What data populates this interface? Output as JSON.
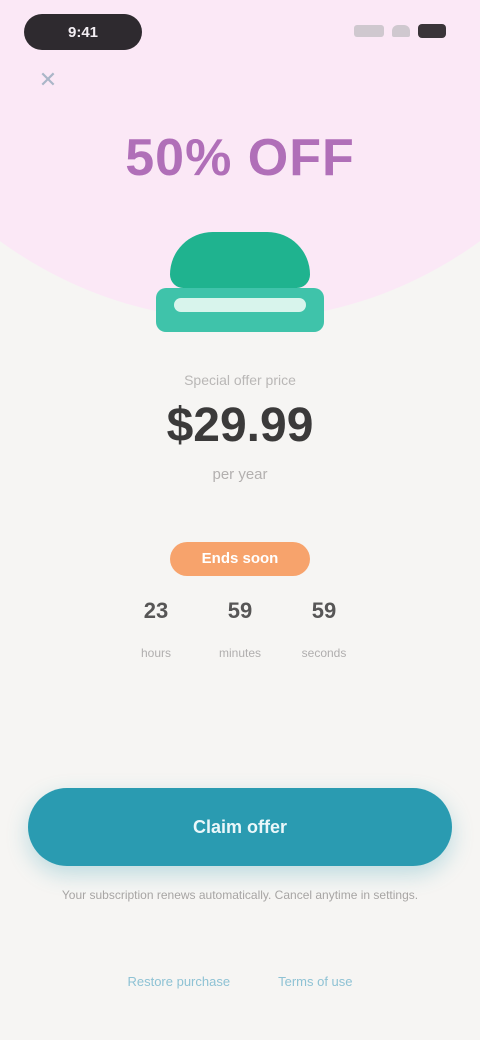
{
  "status_bar": {
    "time": "9:41",
    "icons": [
      "signal-icon",
      "wifi-icon",
      "battery-icon"
    ]
  },
  "header": {
    "close_icon": "close-icon",
    "close_glyph": "✕",
    "offer_title": "50% OFF"
  },
  "product": {
    "logo_icon": "product-logo-icon"
  },
  "pricing": {
    "caption": "Special offer price",
    "price": "$29.99",
    "sub": "per year"
  },
  "timer": {
    "badge": "Ends soon",
    "units": [
      {
        "value": "23",
        "label": "hours"
      },
      {
        "value": "59",
        "label": "minutes"
      },
      {
        "value": "59",
        "label": "seconds"
      }
    ]
  },
  "cta": {
    "label": "Claim offer"
  },
  "fine_print": "Your subscription renews automatically. Cancel anytime in settings.",
  "footer": {
    "links": [
      "Restore purchase",
      "Terms of use"
    ]
  },
  "colors": {
    "hero_bg": "#fbe8f6",
    "title": "#b06fb8",
    "logo": "#1fb38f",
    "badge": "#f7a36c",
    "cta": "#2a9bb1",
    "link": "#8ec2d4"
  }
}
